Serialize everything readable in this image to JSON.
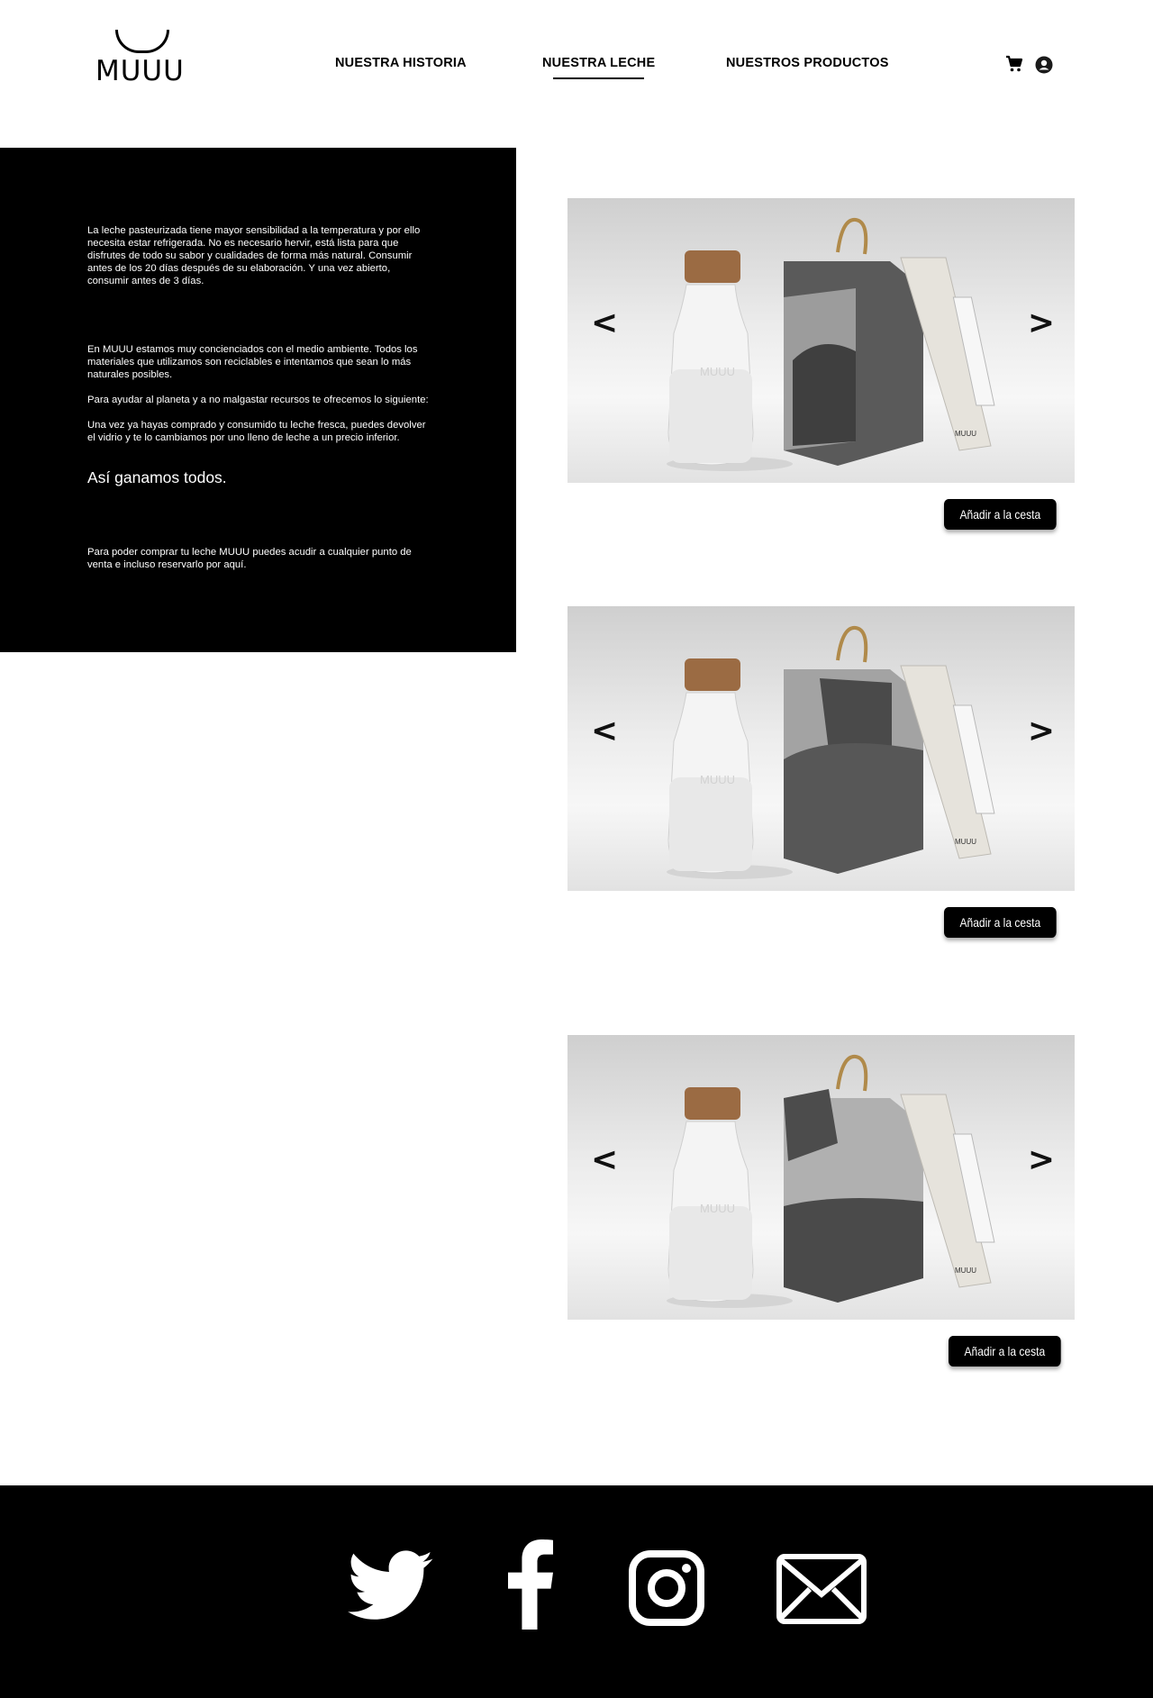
{
  "header": {
    "logo_text": "MUUU",
    "nav": [
      {
        "label": "NUESTRA HISTORIA",
        "active": false
      },
      {
        "label": "NUESTRA LECHE",
        "active": true
      },
      {
        "label": "NUESTROS PRODUCTOS",
        "active": false
      }
    ],
    "icons": [
      "cart-icon",
      "user-account-icon"
    ]
  },
  "info": {
    "p1": "La leche pasteurizada tiene mayor sensibilidad a la temperatura y por ello necesita estar refrigerada. No es necesario hervir, está lista para que disfrutes de todo su sabor y cualidades de forma más natural. Consumir antes de los 20 días después de su elaboración. Y una vez abierto, consumir antes de 3 días.",
    "p2": "En MUUU estamos muy concienciados con el medio ambiente. Todos los materiales que utilizamos son reciclables e intentamos que sean lo más naturales posibles.",
    "p3": "Para ayudar al planeta y a no malgastar recursos te ofrecemos lo siguiente:",
    "p4": "Una vez ya hayas comprado y consumido tu leche fresca, puedes devolver el vidrio y te lo cambiamos por uno lleno de leche a un precio inferior.",
    "highlight": "Así ganamos todos.",
    "p5": "Para poder comprar tu leche MUUU puedes acudir a cualquier punto de venta e incluso reservarlo por aquí."
  },
  "products": [
    {
      "prev": "<",
      "next": ">",
      "bottle_logo": "MUUU",
      "box_logo": "MUUU",
      "button": "Añadir a la cesta"
    },
    {
      "prev": "<",
      "next": ">",
      "bottle_logo": "MUUU",
      "box_logo": "MUUU",
      "button": "Añadir a la cesta"
    },
    {
      "prev": "<",
      "next": ">",
      "bottle_logo": "MUUU",
      "box_logo": "MUUU",
      "button": "Añadir a la cesta"
    }
  ],
  "footer": {
    "icons": [
      "twitter-icon",
      "facebook-icon",
      "instagram-icon",
      "email-icon"
    ]
  },
  "colors": {
    "background": "#ffffff",
    "panel": "#000000",
    "text_on_panel": "#ffffff",
    "button": "#000000"
  }
}
